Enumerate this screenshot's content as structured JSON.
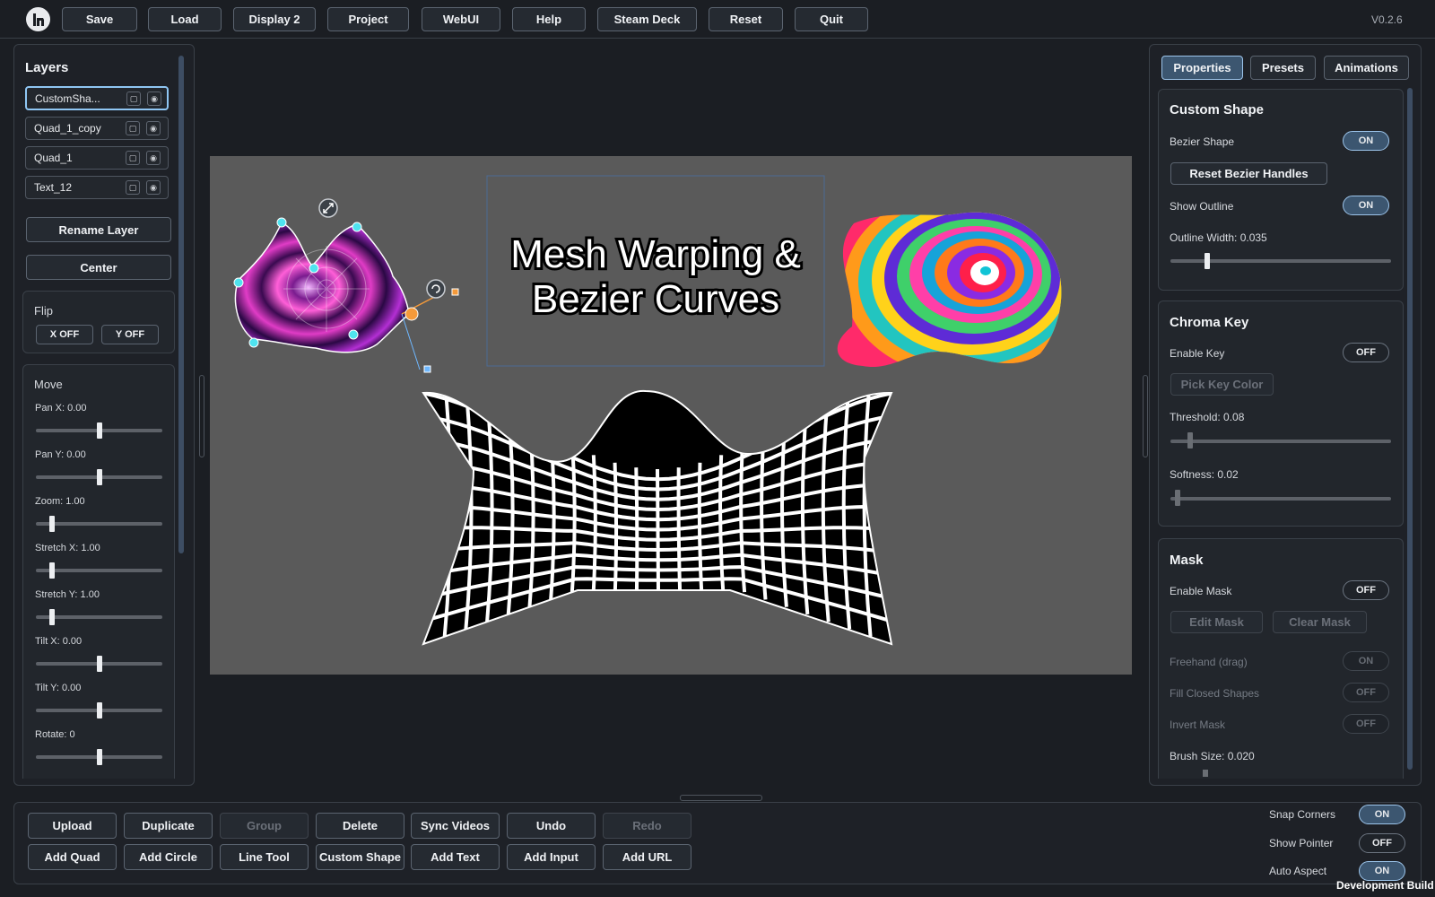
{
  "topbar": {
    "buttons": [
      "Save",
      "Load",
      "Display 2",
      "Project",
      "WebUI",
      "Help",
      "Steam Deck",
      "Reset",
      "Quit"
    ],
    "version": "V0.2.6"
  },
  "layers_panel": {
    "title": "Layers",
    "layers": [
      {
        "name": "CustomSha...",
        "selected": true
      },
      {
        "name": "Quad_1_copy",
        "selected": false
      },
      {
        "name": "Quad_1",
        "selected": false
      },
      {
        "name": "Text_12",
        "selected": false
      }
    ],
    "rename_label": "Rename Layer",
    "center_label": "Center",
    "flip": {
      "title": "Flip",
      "x_label": "X OFF",
      "y_label": "Y OFF"
    },
    "move": {
      "title": "Move",
      "sliders": [
        {
          "label": "Pan X: 0.00",
          "value": 0.5
        },
        {
          "label": "Pan Y: 0.00",
          "value": 0.5
        },
        {
          "label": "Zoom: 1.00",
          "value": 0.13
        },
        {
          "label": "Stretch X: 1.00",
          "value": 0.13
        },
        {
          "label": "Stretch Y: 1.00",
          "value": 0.13
        },
        {
          "label": "Tilt X: 0.00",
          "value": 0.5
        },
        {
          "label": "Tilt Y: 0.00",
          "value": 0.5
        },
        {
          "label": "Rotate: 0",
          "value": 0.5
        }
      ]
    }
  },
  "canvas": {
    "title_line1": "Mesh Warping &",
    "title_line2": "Bezier Curves",
    "background": "#5a5a5a"
  },
  "right_panel": {
    "tabs": [
      {
        "label": "Properties",
        "active": true
      },
      {
        "label": "Presets",
        "active": false
      },
      {
        "label": "Animations",
        "active": false
      }
    ],
    "custom_shape": {
      "title": "Custom Shape",
      "bezier_label": "Bezier Shape",
      "bezier_state": "ON",
      "reset_label": "Reset Bezier Handles",
      "outline_label": "Show Outline",
      "outline_state": "ON",
      "outline_width_label": "Outline Width: 0.035",
      "outline_width_value": 0.035
    },
    "chroma_key": {
      "title": "Chroma Key",
      "enable_label": "Enable Key",
      "enable_state": "OFF",
      "pick_label": "Pick Key Color",
      "threshold_label": "Threshold: 0.08",
      "threshold_value": 0.08,
      "softness_label": "Softness: 0.02",
      "softness_value": 0.02
    },
    "mask": {
      "title": "Mask",
      "enable_label": "Enable Mask",
      "enable_state": "OFF",
      "edit_label": "Edit Mask",
      "clear_label": "Clear Mask",
      "freehand_label": "Freehand (drag)",
      "freehand_state": "ON",
      "fill_label": "Fill Closed Shapes",
      "fill_state": "OFF",
      "invert_label": "Invert Mask",
      "invert_state": "OFF",
      "brush_label": "Brush Size: 0.020"
    }
  },
  "bottombar": {
    "row1": [
      {
        "label": "Upload",
        "enabled": true
      },
      {
        "label": "Duplicate",
        "enabled": true
      },
      {
        "label": "Group",
        "enabled": false
      },
      {
        "label": "Delete",
        "enabled": true
      },
      {
        "label": "Sync Videos",
        "enabled": true
      },
      {
        "label": "Undo",
        "enabled": true
      },
      {
        "label": "Redo",
        "enabled": false
      }
    ],
    "row2": [
      "Add Quad",
      "Add Circle",
      "Line Tool",
      "Custom Shape",
      "Add Text",
      "Add Input",
      "Add URL"
    ],
    "toggles": [
      {
        "label": "Snap Corners",
        "state": "ON"
      },
      {
        "label": "Show Pointer",
        "state": "OFF"
      },
      {
        "label": "Auto Aspect",
        "state": "ON"
      }
    ],
    "dev_build": "Development Build"
  },
  "colors": {
    "accent": "#8fc6f3",
    "handle": "#4fe3ef",
    "bezier_handle": "#f59a3a"
  }
}
